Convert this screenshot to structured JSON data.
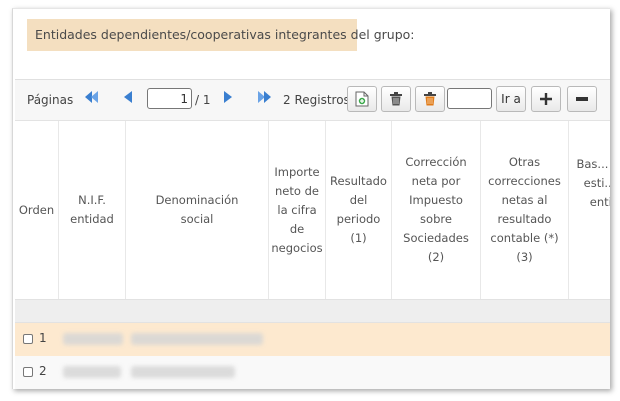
{
  "section": {
    "title": "Entidades dependientes/cooperativas integrantes del grupo:"
  },
  "toolbar": {
    "pages_label": "Páginas",
    "current_page": "1",
    "total_pages": "/ 1",
    "records": "2 Registros",
    "goto_label": "Ir a",
    "goto_value": ""
  },
  "grid": {
    "columns": [
      {
        "header": "Orden"
      },
      {
        "header": "N.I.F. entidad"
      },
      {
        "header": "Denominación social"
      },
      {
        "header": "Importe neto de la cifra de negocios"
      },
      {
        "header": "Resultado del periodo (1)"
      },
      {
        "header": "Corrección neta por Impuesto sobre Sociedades (2)"
      },
      {
        "header": "Otras correcciones netas al resultado contable (*) (3)"
      },
      {
        "header": "Bas... in... en esti... pe... entid... ("
      }
    ],
    "rows": [
      {
        "order": "1",
        "nif": "",
        "name": ""
      },
      {
        "order": "2",
        "nif": "",
        "name": ""
      }
    ]
  },
  "colors": {
    "title_bg": "#f4dfc0",
    "selected_row": "#fde9cf",
    "nav_blue": "#3a7fd0"
  }
}
